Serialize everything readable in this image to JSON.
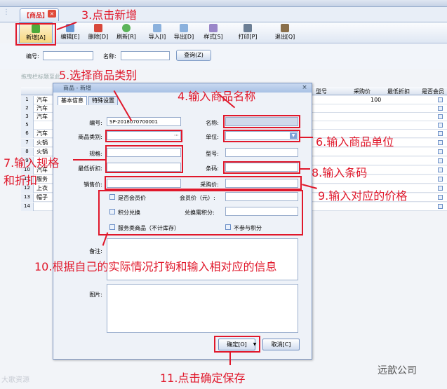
{
  "tab": {
    "label": "【商品】"
  },
  "toolbar": {
    "add": "新增[A]",
    "edit": "编辑[E]",
    "delete": "删除[D]",
    "refresh": "刷新[R]",
    "import": "导入[I]",
    "export": "导出[D]",
    "style": "样式[S]",
    "print": "打印[P]",
    "exit": "退出[Q]"
  },
  "search": {
    "code_label": "编号:",
    "name_label": "名称:",
    "query_button": "查询(Z)"
  },
  "group_hint": "拖曳栏标题至此",
  "grid": {
    "columns": {
      "model": "型号",
      "purchase_price": "采购价",
      "min_discount": "最低折扣",
      "is_member": "是否会员"
    },
    "rows": [
      {
        "n": "1",
        "name": "汽车",
        "price": "100"
      },
      {
        "n": "2",
        "name": "汽车",
        "price": ""
      },
      {
        "n": "3",
        "name": "汽车",
        "price": ""
      },
      {
        "n": "5",
        "name": "",
        "price": ""
      },
      {
        "n": "6",
        "name": "汽车",
        "price": ""
      },
      {
        "n": "7",
        "name": "火锅",
        "price": ""
      },
      {
        "n": "8",
        "name": "火锅",
        "price": ""
      },
      {
        "n": "9",
        "name": "",
        "price": ""
      },
      {
        "n": "10",
        "name": "汽车",
        "price": ""
      },
      {
        "n": "11",
        "name": "服务",
        "price": ""
      },
      {
        "n": "12",
        "name": "上衣",
        "price": ""
      },
      {
        "n": "13",
        "name": "帽子",
        "price": ""
      },
      {
        "n": "14",
        "name": "",
        "price": ""
      }
    ]
  },
  "dialog": {
    "title": "商品 - 新增",
    "tab_basic": "基本信息",
    "tab_special": "特殊设置",
    "code_label": "编号:",
    "code_value": "SP-2018070700001",
    "name_label": "名称:",
    "category_label": "商品类别:",
    "unit_label": "单位:",
    "spec_label": "规格:",
    "model_label": "型号:",
    "min_discount_label": "最低折扣:",
    "barcode_label": "条码:",
    "sale_price_label": "销售价:",
    "purchase_price_label": "采购价:",
    "is_member_price": "是否会员价",
    "member_price_label": "会员价（元）:",
    "points_exchange": "积分兑换",
    "exchange_points_label": "兑换需积分:",
    "service_goods": "服务类商品（不计库存）",
    "no_points": "不参与积分",
    "remark_label": "备注:",
    "picture_label": "图片:",
    "ok_button": "确定[O]",
    "cancel_button": "取消[C]"
  },
  "annotations": {
    "a3": "3.点击新增",
    "a4": "4.输入商品名称",
    "a5": "5.选择商品类别",
    "a6": "6.输入商品单位",
    "a7a": "7.输入规格",
    "a7b": "和折扣",
    "a8": "8.输入条码",
    "a9": "9.输入对应的价格",
    "a10": "10.根据自己的实际情况打钩和输入相对应的信息",
    "a11": "11.点击确定保存"
  },
  "watermark": {
    "left": "大歌资源",
    "right": "远歆公司"
  },
  "colors": {
    "annotation": "#e0182b",
    "accent": "#7aa0d6"
  }
}
